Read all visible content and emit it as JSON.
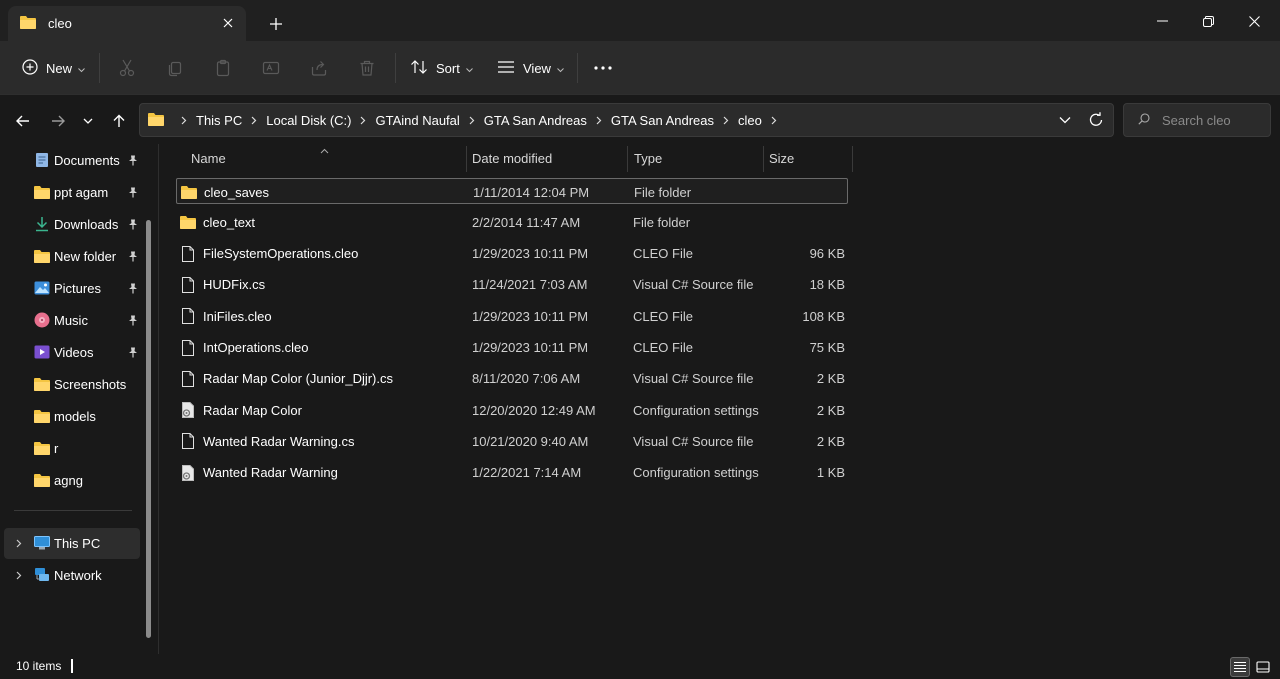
{
  "tab": {
    "title": "cleo",
    "icon": "folder-icon"
  },
  "window_controls": [
    "minimize-icon",
    "restore-icon",
    "close-icon"
  ],
  "toolbar": {
    "new_label": "New",
    "sort_label": "Sort",
    "view_label": "View",
    "icons": [
      "cut-icon",
      "copy-icon",
      "paste-icon",
      "rename-icon",
      "share-icon",
      "delete-icon",
      "more-icon"
    ]
  },
  "address": {
    "crumbs": [
      "This PC",
      "Local Disk (C:)",
      "GTAind Naufal",
      "GTA San Andreas",
      "GTA San Andreas",
      "cleo"
    ]
  },
  "search": {
    "placeholder": "Search cleo"
  },
  "sidebar": {
    "quick_access": [
      {
        "label": "Documents",
        "icon": "documents-icon",
        "pinned": true
      },
      {
        "label": "ppt agam",
        "icon": "folder-icon",
        "pinned": true
      },
      {
        "label": "Downloads",
        "icon": "downloads-icon",
        "pinned": true
      },
      {
        "label": "New folder",
        "icon": "folder-icon",
        "pinned": true
      },
      {
        "label": "Pictures",
        "icon": "pictures-icon",
        "pinned": true
      },
      {
        "label": "Music",
        "icon": "music-icon",
        "pinned": true
      },
      {
        "label": "Videos",
        "icon": "videos-icon",
        "pinned": true
      },
      {
        "label": "Screenshots",
        "icon": "folder-icon",
        "pinned": false
      },
      {
        "label": "models",
        "icon": "folder-icon",
        "pinned": false
      },
      {
        "label": "r",
        "icon": "folder-icon",
        "pinned": false
      },
      {
        "label": "agng",
        "icon": "folder-icon",
        "pinned": false
      }
    ],
    "this_pc": "This PC",
    "network": "Network"
  },
  "columns": {
    "name": "Name",
    "date": "Date modified",
    "type": "Type",
    "size": "Size"
  },
  "files": [
    {
      "name": "cleo_saves",
      "date": "1/11/2014 12:04 PM",
      "type": "File folder",
      "size": "",
      "icon": "folder-icon",
      "selected": true
    },
    {
      "name": "cleo_text",
      "date": "2/2/2014 11:47 AM",
      "type": "File folder",
      "size": "",
      "icon": "folder-icon",
      "selected": false
    },
    {
      "name": "FileSystemOperations.cleo",
      "date": "1/29/2023 10:11 PM",
      "type": "CLEO File",
      "size": "96 KB",
      "icon": "file-icon",
      "selected": false
    },
    {
      "name": "HUDFix.cs",
      "date": "11/24/2021 7:03 AM",
      "type": "Visual C# Source file",
      "size": "18 KB",
      "icon": "file-icon",
      "selected": false
    },
    {
      "name": "IniFiles.cleo",
      "date": "1/29/2023 10:11 PM",
      "type": "CLEO File",
      "size": "108 KB",
      "icon": "file-icon",
      "selected": false
    },
    {
      "name": "IntOperations.cleo",
      "date": "1/29/2023 10:11 PM",
      "type": "CLEO File",
      "size": "75 KB",
      "icon": "file-icon",
      "selected": false
    },
    {
      "name": "Radar Map Color (Junior_Djjr).cs",
      "date": "8/11/2020 7:06 AM",
      "type": "Visual C# Source file",
      "size": "2 KB",
      "icon": "file-icon",
      "selected": false
    },
    {
      "name": "Radar Map Color",
      "date": "12/20/2020 12:49 AM",
      "type": "Configuration settings",
      "size": "2 KB",
      "icon": "config-file-icon",
      "selected": false
    },
    {
      "name": "Wanted Radar Warning.cs",
      "date": "10/21/2020 9:40 AM",
      "type": "Visual C# Source file",
      "size": "2 KB",
      "icon": "file-icon",
      "selected": false
    },
    {
      "name": "Wanted Radar Warning",
      "date": "1/22/2021 7:14 AM",
      "type": "Configuration settings",
      "size": "1 KB",
      "icon": "config-file-icon",
      "selected": false
    }
  ],
  "status": {
    "count": "10 items"
  },
  "colors": {
    "folder": "#f4c542",
    "accent": "#4cc2ff",
    "background": "#191919",
    "panel": "#2b2b2b"
  }
}
